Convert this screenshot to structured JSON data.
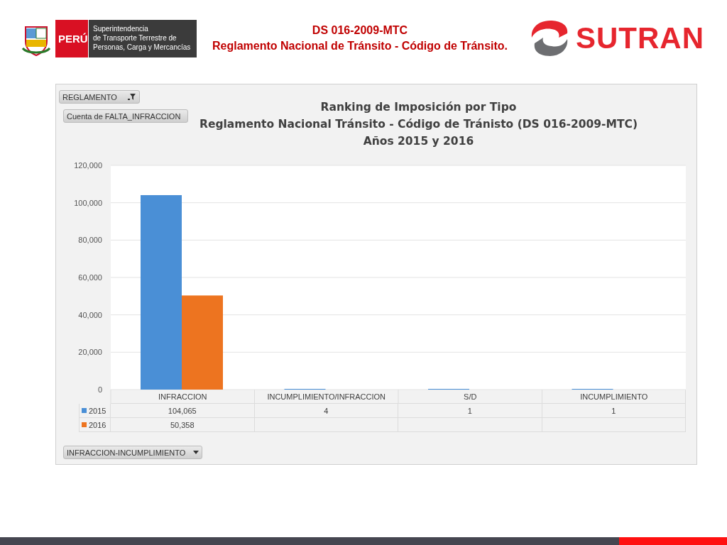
{
  "header": {
    "peru_badge": "PERÚ",
    "agency_lines": [
      "Superintendencia",
      "de Transporte Terrestre de",
      "Personas, Carga y Mercancías"
    ],
    "title_lines": [
      "DS 016-2009-MTC",
      "Reglamento Nacional de Tránsito - Código de Tránsito."
    ],
    "logo_text": "SUTRAN"
  },
  "pivot_chart": {
    "filter_button": "REGLAMENTO",
    "value_field": "Cuenta de FALTA_INFRACCION",
    "title_lines": [
      "Ranking de Imposición por Tipo",
      "Reglamento Nacional Tránsito -  Código de Tránisto (DS 016-2009-MTC)",
      "Años 2015 y 2016"
    ],
    "chart_data": {
      "type": "bar",
      "categories": [
        "INFRACCION",
        "INCUMPLIMIENTO/INFRACCION",
        "S/D",
        "INCUMPLIMIENTO"
      ],
      "series": [
        {
          "name": "2015",
          "color": "#4a8fd6",
          "values": [
            104065,
            4,
            1,
            1
          ]
        },
        {
          "name": "2016",
          "color": "#ed7420",
          "values": [
            50358,
            null,
            null,
            null
          ]
        }
      ],
      "ylim": [
        0,
        120000
      ],
      "grid": true,
      "yticks": [
        {
          "value": 0,
          "label": "0"
        },
        {
          "value": 20000,
          "label": "20,000"
        },
        {
          "value": 40000,
          "label": "40,000"
        },
        {
          "value": 60000,
          "label": "60,000"
        },
        {
          "value": 80000,
          "label": "80,000"
        },
        {
          "value": 100000,
          "label": "100,000"
        },
        {
          "value": 120000,
          "label": "120,000"
        }
      ]
    },
    "data_table": [
      [
        "104,065",
        "4",
        "1",
        "1"
      ],
      [
        "50,358"
      ]
    ],
    "axis_field_button": "INFRACCION-INCUMPLIMIENTO"
  }
}
